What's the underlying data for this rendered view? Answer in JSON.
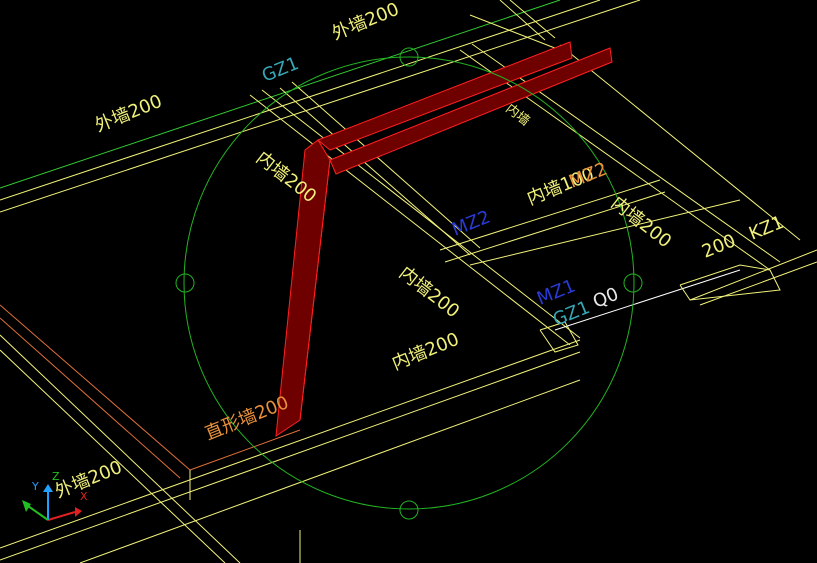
{
  "colors": {
    "background": "#000000",
    "wall_yellow": "#f2f27a",
    "wall_green": "#33cc33",
    "wall_orange": "#e0703a",
    "wall_white": "#ffffff",
    "label_yellow": "#f0f07a",
    "label_cyan": "#35a8b8",
    "label_blue": "#2a3ad8",
    "label_orange": "#e8903a",
    "label_white": "#e8e8e8",
    "beam_fill": "#6e0000",
    "beam_edge": "#ff2020",
    "selection_circle": "#22b322",
    "grip": "#22b322",
    "axis_x": "#e02020",
    "axis_y": "#20a0ff",
    "axis_z": "#20c020"
  },
  "labels": {
    "top_wall": "外墙200",
    "left_wall": "外墙200",
    "bottom_wall": "外墙200",
    "gz1_top": "GZ1",
    "inner_diag_1": "内墙200",
    "inner_diag_2": "内墙200",
    "inner_wall_mid": "内墙200",
    "inner_wall_right": "内墙200",
    "inner_wall_upper_right": "内墙",
    "inner_100": "内墙100",
    "mz2_blue": "MZ2",
    "mz2_orange": "MZ2",
    "mz1": "MZ1",
    "gz1_mid": "GZ1",
    "q100": "Q0",
    "kz1": "KZ1",
    "right_200": "200",
    "arc_wall": "直形墙200"
  },
  "ucs": {
    "x": "X",
    "y": "Y",
    "z": "Z"
  },
  "icons": {
    "ucs": "ucs-axis-icon",
    "grip": "grip-handle-icon"
  }
}
